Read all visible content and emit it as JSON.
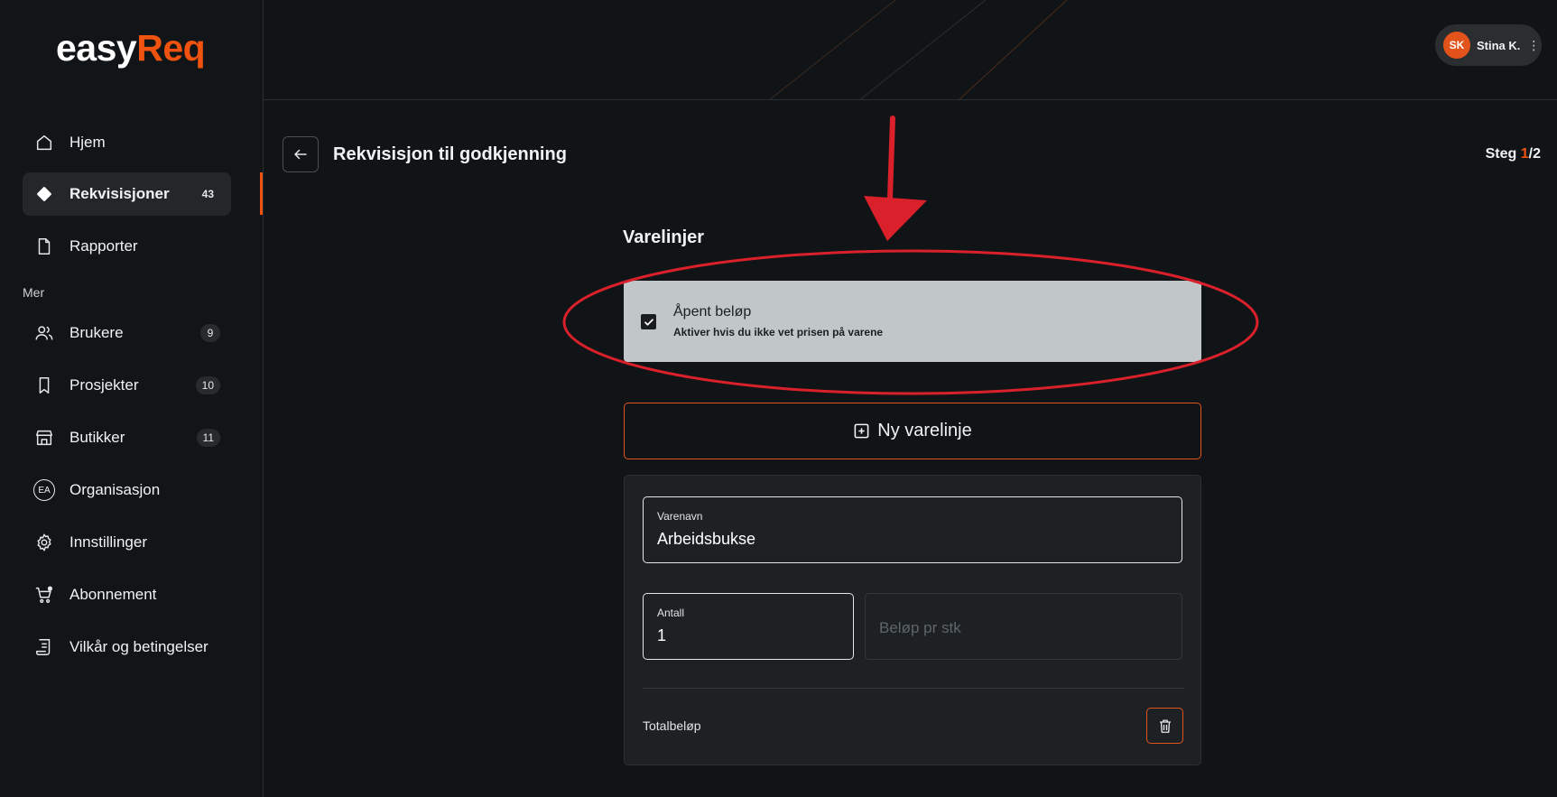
{
  "brand": {
    "part1": "easy",
    "part2": "Req",
    "accent": "#f0520f"
  },
  "sidebar": {
    "items": [
      {
        "label": "Hjem",
        "icon": "home-icon",
        "badge": ""
      },
      {
        "label": "Rekvisisjoner",
        "icon": "diamond-icon",
        "badge": "43",
        "active": true
      },
      {
        "label": "Rapporter",
        "icon": "document-icon",
        "badge": ""
      }
    ],
    "section_label": "Mer",
    "more_items": [
      {
        "label": "Brukere",
        "icon": "users-icon",
        "badge": "9"
      },
      {
        "label": "Prosjekter",
        "icon": "bookmark-icon",
        "badge": "10"
      },
      {
        "label": "Butikker",
        "icon": "store-icon",
        "badge": "11"
      },
      {
        "label": "Organisasjon",
        "icon": "organization-icon",
        "badge": "",
        "icon_text": "EA"
      },
      {
        "label": "Innstillinger",
        "icon": "gear-icon",
        "badge": ""
      },
      {
        "label": "Abonnement",
        "icon": "cart-icon",
        "badge": ""
      },
      {
        "label": "Vilkår og betingelser",
        "icon": "receipt-icon",
        "badge": ""
      }
    ]
  },
  "header": {
    "user_initials": "SK",
    "user_name": "Stina K.",
    "menu_glyph": "⋮"
  },
  "page": {
    "title": "Rekvisisjon til godkjenning",
    "step_prefix": "Steg ",
    "step_current": "1",
    "step_total": "/2"
  },
  "item_lines": {
    "section_title": "Varelinjer",
    "open_amount": {
      "title": "Åpent beløp",
      "subtitle": "Aktiver hvis du ikke vet prisen på varene",
      "checked": true
    },
    "new_line_label": "Ny varelinje",
    "line": {
      "name_label": "Varenavn",
      "name_value": "Arbeidsbukse",
      "qty_label": "Antall",
      "qty_value": "1",
      "price_placeholder": "Beløp pr stk",
      "total_label": "Totalbeløp"
    }
  },
  "colors": {
    "background": "#111416",
    "annotation": "#d9202b"
  }
}
